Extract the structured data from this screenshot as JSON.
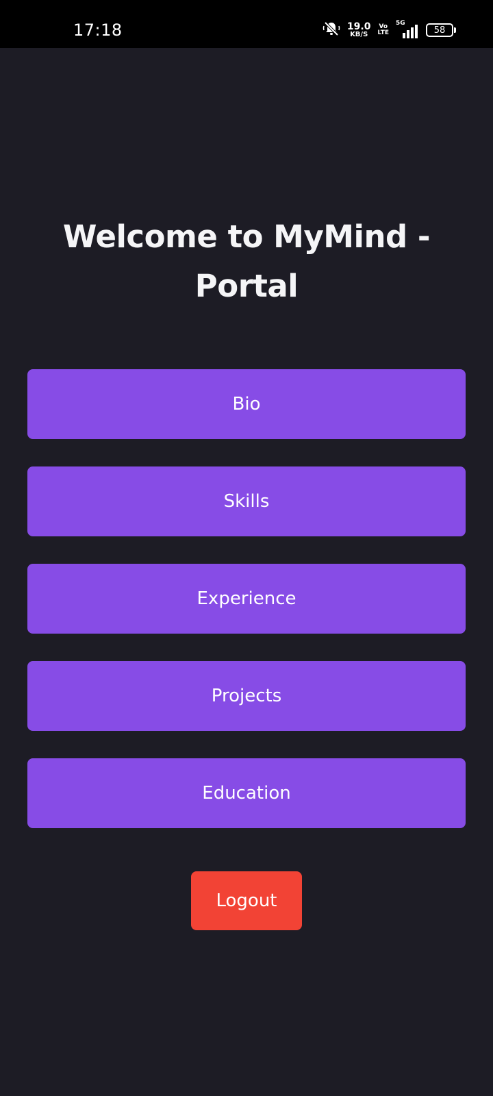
{
  "status_bar": {
    "time": "17:18",
    "net_speed_value": "19.0",
    "net_speed_unit": "KB/S",
    "volte_top": "Vo",
    "volte_bottom": "LTE",
    "network_type": "5G",
    "battery_level": "58",
    "icons": [
      "bell-muted-icon",
      "signal-icon",
      "battery-icon"
    ]
  },
  "header": {
    "title": "Welcome to MyMind - Portal"
  },
  "menu": {
    "items": [
      {
        "label": "Bio"
      },
      {
        "label": "Skills"
      },
      {
        "label": "Experience"
      },
      {
        "label": "Projects"
      },
      {
        "label": "Education"
      }
    ]
  },
  "logout": {
    "label": "Logout"
  },
  "colors": {
    "background": "#1d1c25",
    "accent": "#874ce6",
    "danger": "#f24335"
  }
}
